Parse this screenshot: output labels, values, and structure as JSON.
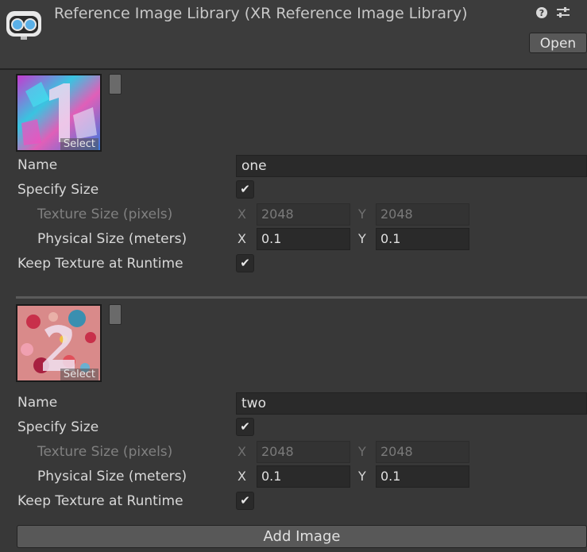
{
  "header": {
    "title": "Reference Image Library (XR Reference Image Library)",
    "open_label": "Open",
    "logo_icon": "xr-headset-icon",
    "help_icon": "help-icon",
    "settings_icon": "settings-sliders-icon"
  },
  "images": [
    {
      "select_label": "Select",
      "labels": {
        "name": "Name",
        "specify_size": "Specify Size",
        "texture_size": "Texture Size (pixels)",
        "physical_size": "Physical Size (meters)",
        "keep_texture": "Keep Texture at Runtime"
      },
      "name_value": "one",
      "specify_size_checked": true,
      "texture_size": {
        "x_label": "X",
        "x": "2048",
        "y_label": "Y",
        "y": "2048"
      },
      "physical_size": {
        "x_label": "X",
        "x": "0.1",
        "y_label": "Y",
        "y": "0.1"
      },
      "keep_texture_checked": true,
      "check_glyph": "✔"
    },
    {
      "select_label": "Select",
      "labels": {
        "name": "Name",
        "specify_size": "Specify Size",
        "texture_size": "Texture Size (pixels)",
        "physical_size": "Physical Size (meters)",
        "keep_texture": "Keep Texture at Runtime"
      },
      "name_value": "two",
      "specify_size_checked": true,
      "texture_size": {
        "x_label": "X",
        "x": "2048",
        "y_label": "Y",
        "y": "2048"
      },
      "physical_size": {
        "x_label": "X",
        "x": "0.1",
        "y_label": "Y",
        "y": "0.1"
      },
      "keep_texture_checked": true,
      "check_glyph": "✔"
    }
  ],
  "add_image_label": "Add Image"
}
